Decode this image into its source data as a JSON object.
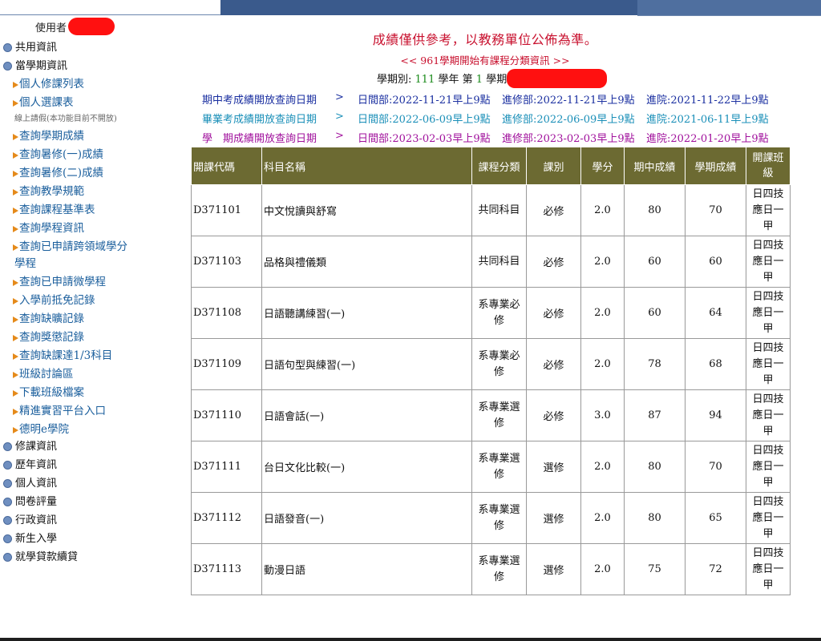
{
  "user": {
    "label": "使用者"
  },
  "sidebar": {
    "top_items": [
      {
        "label": "共用資訊"
      },
      {
        "label": "當學期資訊"
      }
    ],
    "sub_items": [
      {
        "label": "個人修課列表"
      },
      {
        "label": "個人選課表"
      },
      {
        "label": "查詢學期成績"
      },
      {
        "label": "查詢暑修(一)成績"
      },
      {
        "label": "查詢暑修(二)成績"
      },
      {
        "label": "查詢教學規範"
      },
      {
        "label": "查詢課程基準表"
      },
      {
        "label": "查詢學程資訊"
      },
      {
        "label": "查詢已申請跨領域學分"
      },
      {
        "label": "學程"
      },
      {
        "label": "查詢已申請微學程"
      },
      {
        "label": "入學前抵免記錄"
      },
      {
        "label": "查詢缺曠記錄"
      },
      {
        "label": "查詢獎懲記錄"
      },
      {
        "label": "查詢缺課達1/3科目"
      },
      {
        "label": "班級討論區"
      },
      {
        "label": "下載班級檔案"
      },
      {
        "label": "精進實習平台入口"
      },
      {
        "label": "德明e學院"
      }
    ],
    "note": "線上請假(本功能目前不開放)",
    "bottom_items": [
      {
        "label": "修課資訊"
      },
      {
        "label": "歷年資訊"
      },
      {
        "label": "個人資訊"
      },
      {
        "label": "問卷評量"
      },
      {
        "label": "行政資訊"
      },
      {
        "label": "新生入學"
      },
      {
        "label": "就學貸款續貸"
      }
    ]
  },
  "header": {
    "notice": "成績僅供參考，以教務單位公佈為準。",
    "subnotice": "<< 961學期開始有課程分類資訊 >>",
    "term_label_pre": "學期別:",
    "term_year": "111",
    "term_label_mid": "學年 第",
    "term_no": "1",
    "term_label_post": "學期"
  },
  "dates": [
    {
      "label": "期中考成績開放查詢日期",
      "arrow": ">",
      "day": "日間部:2022-11-21早上9點",
      "ext": "進修部:2022-11-21早上9點",
      "inst": "進院:2021-11-22早上9點"
    },
    {
      "label": "畢業考成績開放查詢日期",
      "arrow": ">",
      "day": "日間部:2022-06-09早上9點",
      "ext": "進修部:2022-06-09早上9點",
      "inst": "進院:2021-06-11早上9點"
    },
    {
      "label": "學　期成績開放查詢日期",
      "arrow": ">",
      "day": "日間部:2023-02-03早上9點",
      "ext": "進修部:2023-02-03早上9點",
      "inst": "進院:2022-01-20早上9點"
    }
  ],
  "table": {
    "headers": [
      "開課代碼",
      "科目名稱",
      "課程分類",
      "課別",
      "學分",
      "期中成績",
      "學期成績",
      "開課班級"
    ],
    "rows": [
      {
        "code": "D371101",
        "name": "中文悅讀與舒寫",
        "category": "共同科目",
        "type": "必修",
        "credit": "2.0",
        "mid": "80",
        "final": "70",
        "class": "日四技應日一甲"
      },
      {
        "code": "D371103",
        "name": "品格與禮儀類",
        "category": "共同科目",
        "type": "必修",
        "credit": "2.0",
        "mid": "60",
        "final": "60",
        "class": "日四技應日一甲"
      },
      {
        "code": "D371108",
        "name": "日語聽講練習(一)",
        "category": "系專業必修",
        "type": "必修",
        "credit": "2.0",
        "mid": "60",
        "final": "64",
        "class": "日四技應日一甲"
      },
      {
        "code": "D371109",
        "name": "日語句型與練習(一)",
        "category": "系專業必修",
        "type": "必修",
        "credit": "2.0",
        "mid": "78",
        "final": "68",
        "class": "日四技應日一甲"
      },
      {
        "code": "D371110",
        "name": "日語會話(一)",
        "category": "系專業選修",
        "type": "必修",
        "credit": "3.0",
        "mid": "87",
        "final": "94",
        "class": "日四技應日一甲"
      },
      {
        "code": "D371111",
        "name": "台日文化比較(一)",
        "category": "系專業選修",
        "type": "選修",
        "credit": "2.0",
        "mid": "80",
        "final": "70",
        "class": "日四技應日一甲"
      },
      {
        "code": "D371112",
        "name": "日語發音(一)",
        "category": "系專業選修",
        "type": "選修",
        "credit": "2.0",
        "mid": "80",
        "final": "65",
        "class": "日四技應日一甲"
      },
      {
        "code": "D371113",
        "name": "動漫日語",
        "category": "系專業選修",
        "type": "選修",
        "credit": "2.0",
        "mid": "75",
        "final": "72",
        "class": "日四技應日一甲"
      }
    ]
  },
  "colors": {
    "header_bg": "#6c6a32",
    "notice": "#c8102e",
    "mid_row": "#1a2fa0",
    "grad_row": "#1a8fb8",
    "term_row": "#a0109c",
    "sidebar_link": "#1a5e9c"
  }
}
